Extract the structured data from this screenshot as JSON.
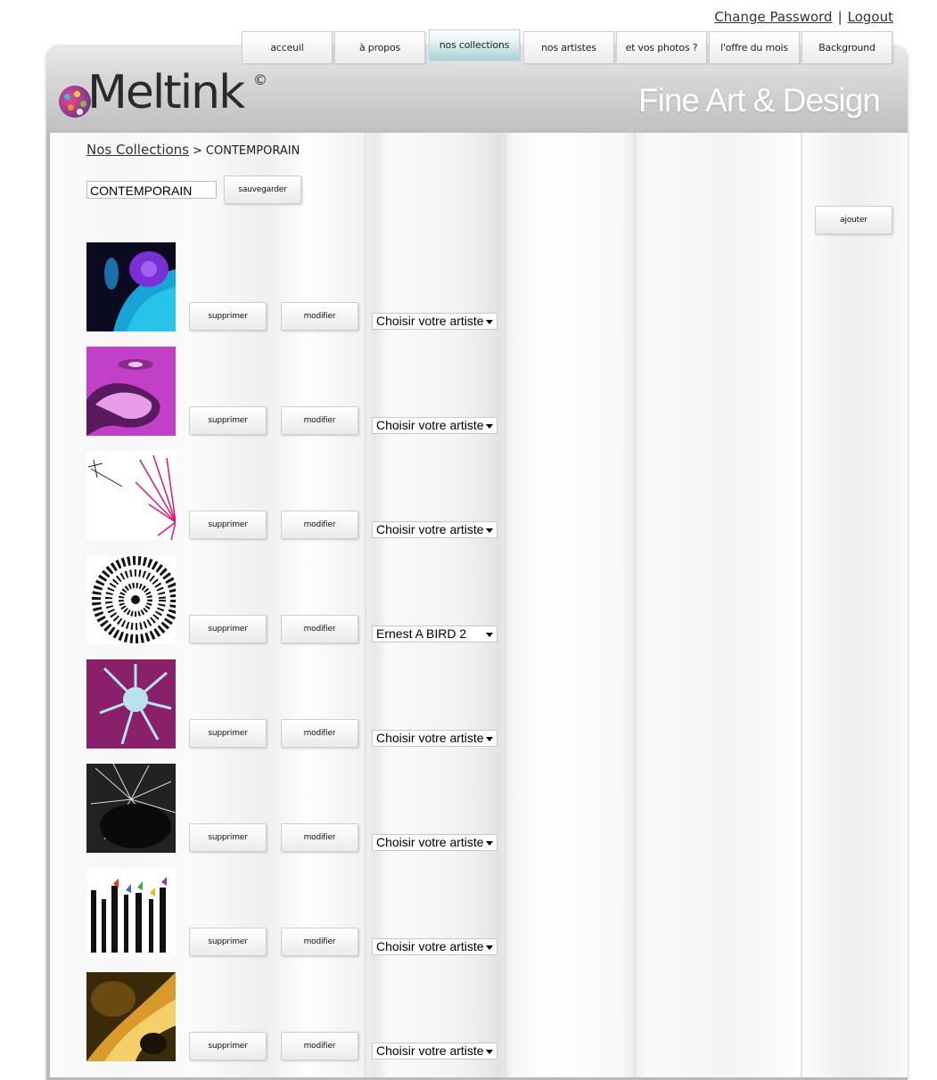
{
  "account": {
    "change_password": "Change Password",
    "separator": "|",
    "logout": "Logout"
  },
  "nav": {
    "tabs": [
      {
        "label": "acceuil",
        "active": false
      },
      {
        "label": "à propos",
        "active": false
      },
      {
        "label": "nos collections",
        "active": true
      },
      {
        "label": "nos artistes",
        "active": false
      },
      {
        "label": "et vos photos ?",
        "active": false
      },
      {
        "label": "l'offre du mois",
        "active": false
      },
      {
        "label": "Background",
        "active": false
      }
    ]
  },
  "brand": {
    "logo_text": "Meltink",
    "logo_mark": "©",
    "tagline": "Fine Art & Design"
  },
  "breadcrumb": {
    "parent": "Nos Collections",
    "separator": ">",
    "current": "CONTEMPORAIN"
  },
  "collection_form": {
    "name_value": "CONTEMPORAIN",
    "save_label": "sauvegarder",
    "add_label": "ajouter"
  },
  "row_actions": {
    "delete_label": "supprimer",
    "edit_label": "modifier"
  },
  "items": [
    {
      "artist": "Choisir votre artiste",
      "thumb": "blue-purple-abstract"
    },
    {
      "artist": "Choisir votre artiste",
      "thumb": "pink-swirl"
    },
    {
      "artist": "Choisir votre artiste",
      "thumb": "pink-dandelion"
    },
    {
      "artist": "Ernest A BIRD 2",
      "thumb": "black-white-sunflower"
    },
    {
      "artist": "Choisir votre artiste",
      "thumb": "purple-blue-flower"
    },
    {
      "artist": "Choisir votre artiste",
      "thumb": "black-spiky-texture"
    },
    {
      "artist": "Choisir votre artiste",
      "thumb": "ink-strokes-flags"
    },
    {
      "artist": "Choisir votre artiste",
      "thumb": "golden-swirl"
    }
  ],
  "colors": {
    "active_tab": "#a5d1d8",
    "header_gray": "#bfbfbf",
    "tagline": "#ffffff"
  }
}
